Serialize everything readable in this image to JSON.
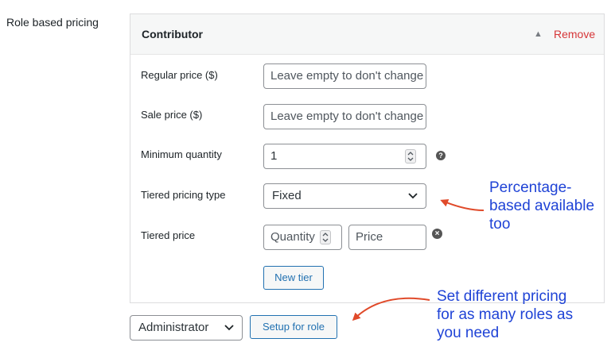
{
  "section": {
    "label": "Role based pricing"
  },
  "panel": {
    "title": "Contributor",
    "remove_label": "Remove"
  },
  "fields": {
    "regular_price": {
      "label": "Regular price ($)",
      "placeholder": "Leave empty to don't change"
    },
    "sale_price": {
      "label": "Sale price ($)",
      "placeholder": "Leave empty to don't change"
    },
    "minimum_quantity": {
      "label": "Minimum quantity",
      "value": "1"
    },
    "tiered_pricing_type": {
      "label": "Tiered pricing type",
      "selected": "Fixed"
    },
    "tiered_price": {
      "label": "Tiered price",
      "quantity_placeholder": "Quantity",
      "price_placeholder": "Price"
    }
  },
  "buttons": {
    "new_tier": "New tier",
    "setup_for_role": "Setup for role"
  },
  "role_select": {
    "selected": "Administrator"
  },
  "annotations": {
    "tiered_type_note": [
      "Percentage-",
      "based available",
      "too"
    ],
    "roles_note": [
      "Set different pricing",
      "for as many roles as",
      "you need"
    ]
  },
  "colors": {
    "annotation_text": "#1f43d6",
    "annotation_arrow": "#e04a2a",
    "remove": "#d63638",
    "button": "#2271b1"
  },
  "icons": {
    "toggle": "triangle-up-icon",
    "help": "question-mark-icon",
    "clear": "close-circle-icon",
    "dropdown": "chevron-down-icon",
    "spinner": "number-spinner-icon"
  }
}
